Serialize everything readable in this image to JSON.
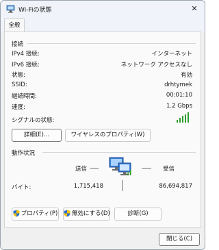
{
  "window": {
    "title": "Wi-Fiの状態",
    "close_glyph": "✕"
  },
  "tabs": [
    {
      "label": "全般"
    }
  ],
  "connection": {
    "header": "接続",
    "rows": [
      {
        "label": "IPv4 接続:",
        "value": "インターネット"
      },
      {
        "label": "IPv6 接続:",
        "value": "ネットワーク アクセスなし"
      },
      {
        "label": "状態:",
        "value": "有効"
      },
      {
        "label": "SSID:",
        "value": "drhtymek"
      },
      {
        "label": "継続時間:",
        "value": "00:01:10"
      },
      {
        "label": "速度:",
        "value": "1.2 Gbps"
      }
    ],
    "signal_label": "シグナルの状態:",
    "signal_bars": 5,
    "details_button": "詳細(E)...",
    "wireless_props_button": "ワイヤレスのプロパティ(W)"
  },
  "activity": {
    "header": "動作状況",
    "sent_label": "送信",
    "received_label": "受信",
    "bytes_label": "バイト:",
    "bytes_sent": "1,715,418",
    "bytes_received": "86,694,817"
  },
  "actions": {
    "properties_button": "プロパティ(P)",
    "disable_button": "無効にする(D)",
    "diagnose_button": "診断(G)"
  },
  "footer": {
    "close_button": "閉じる(C)"
  },
  "colors": {
    "signal_green": "#2e9a2e",
    "shield_blue": "#2d6fd0",
    "shield_yellow": "#f2c200"
  }
}
